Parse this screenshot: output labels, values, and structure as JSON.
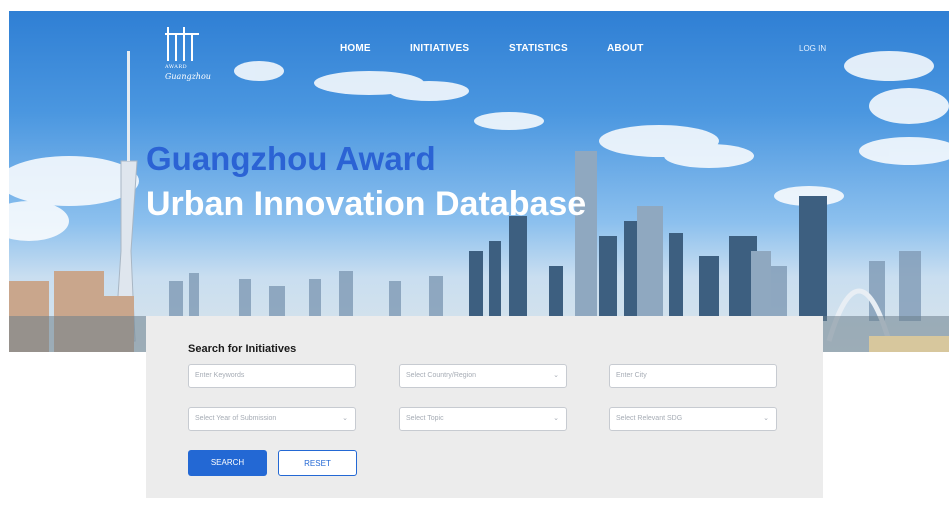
{
  "header": {
    "logo": {
      "line1": "AWARD",
      "line2": "Guangzhou"
    },
    "nav": [
      {
        "label": "HOME"
      },
      {
        "label": "INITIATIVES"
      },
      {
        "label": "STATISTICS"
      },
      {
        "label": "ABOUT"
      }
    ],
    "login": "LOG IN"
  },
  "hero": {
    "title_line1": "Guangzhou Award",
    "title_line2": "Urban Innovation Database"
  },
  "search": {
    "title": "Search for Initiatives",
    "keywords_placeholder": "Enter Keywords",
    "country_placeholder": "Select Country/Region",
    "city_placeholder": "Enter City",
    "year_placeholder": "Select Year of Submission",
    "topic_placeholder": "Select Topic",
    "sdg_placeholder": "Select Relevant SDG",
    "search_label": "SEARCH",
    "reset_label": "RESET"
  },
  "colors": {
    "accent": "#2368d4",
    "title_blue": "#2b63d4",
    "panel": "#ececec"
  },
  "icons": {
    "dropdown": "chevron-down-icon"
  }
}
